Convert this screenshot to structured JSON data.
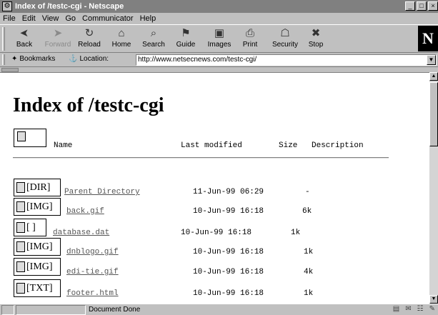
{
  "window": {
    "title": "Index of /testc-cgi - Netscape",
    "app_glyph": "⚙",
    "controls": [
      "_",
      "□",
      "×"
    ]
  },
  "menu": [
    "File",
    "Edit",
    "View",
    "Go",
    "Communicator",
    "Help"
  ],
  "toolbar": {
    "buttons": [
      {
        "label": "Back",
        "icon": "back-icon",
        "glyph": "➤",
        "enabled": true
      },
      {
        "label": "Forward",
        "icon": "forward-icon",
        "glyph": "➤",
        "enabled": false
      },
      {
        "label": "Reload",
        "icon": "reload-icon",
        "glyph": "↻",
        "enabled": true
      },
      {
        "label": "Home",
        "icon": "home-icon",
        "glyph": "⌂",
        "enabled": true
      },
      {
        "label": "Search",
        "icon": "search-icon",
        "glyph": "⌕",
        "enabled": true
      },
      {
        "label": "Guide",
        "icon": "guide-icon",
        "glyph": "⚑",
        "enabled": true
      },
      {
        "label": "Images",
        "icon": "images-icon",
        "glyph": "▣",
        "enabled": true
      },
      {
        "label": "Print",
        "icon": "print-icon",
        "glyph": "⎙",
        "enabled": true
      },
      {
        "label": "Security",
        "icon": "security-icon",
        "glyph": "☖",
        "enabled": true
      },
      {
        "label": "Stop",
        "icon": "stop-icon",
        "glyph": "✖",
        "enabled": true
      }
    ],
    "logo": "N"
  },
  "location": {
    "bookmarks_label": "Bookmarks",
    "location_label": "Location:",
    "url": "http://www.netsecnews.com/testc-cgi/"
  },
  "page": {
    "heading": "Index of /testc-cgi",
    "columns": {
      "name": "Name",
      "last_modified": "Last modified",
      "size": "Size",
      "description": "Description"
    },
    "entries": [
      {
        "alt": "[DIR]",
        "name": "Parent Directory",
        "modified": "11-Jun-99 06:29",
        "size": "-"
      },
      {
        "alt": "[IMG]",
        "name": "back.gif",
        "modified": "10-Jun-99 16:18",
        "size": "6k"
      },
      {
        "alt": "[ ]",
        "name": "database.dat",
        "modified": "10-Jun-99 16:18",
        "size": "1k"
      },
      {
        "alt": "[IMG]",
        "name": "dnblogo.gif",
        "modified": "10-Jun-99 16:18",
        "size": "1k"
      },
      {
        "alt": "[IMG]",
        "name": "edi-tie.gif",
        "modified": "10-Jun-99 16:18",
        "size": "4k"
      },
      {
        "alt": "[TXT]",
        "name": "footer.html",
        "modified": "10-Jun-99 16:18",
        "size": "1k"
      }
    ]
  },
  "status": {
    "text": "Document Done"
  }
}
